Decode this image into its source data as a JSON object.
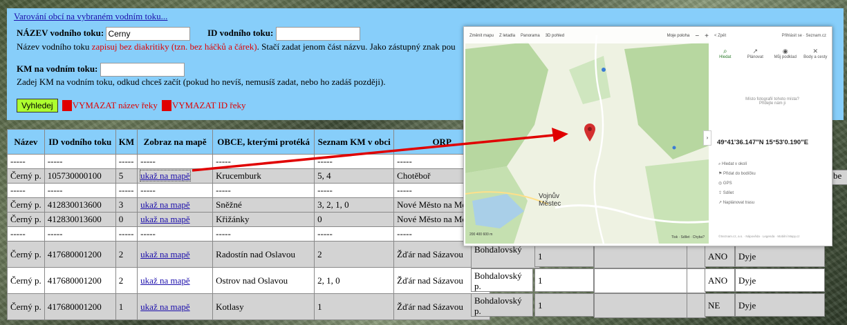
{
  "search": {
    "title_link": "Varování obcí na vybraném vodním toku...",
    "name_label": "NÁZEV vodního toku:",
    "name_value": "Cerny",
    "id_label": "ID vodního toku:",
    "id_value": "",
    "hint_prefix": "Název vodního toku ",
    "hint_red": "zapisuj bez diakritiky (tzn. bez háčků a čárek)",
    "hint_suffix": ". Stačí zadat jenom část názvu. Jako zástupný znak pou",
    "km_label": "KM na vodním toku:",
    "km_value": "",
    "km_hint": "Zadej KM na vodním toku, odkud chceš začít (pokud ho nevíš, nemusíš zadat, nebo ho zadáš později).",
    "search_button": "Vyhledej",
    "clear_name": "VYMAZAT název řeky",
    "clear_id": "VYMAZAT ID řeky"
  },
  "table": {
    "headers": [
      "Název",
      "ID vodního toku",
      "KM",
      "Zobraz na mapě",
      "OBCE, kterými protéká",
      "Seznam KM v obci",
      "ORP"
    ],
    "rows": [
      [
        "-----",
        "-----",
        "-----",
        "-----",
        "-----",
        "-----",
        "-----"
      ],
      [
        "Černý p.",
        "105730000100",
        "5",
        "ukaž na mapě",
        "Krucemburk",
        "5, 4",
        "Chotěboř"
      ],
      [
        "-----",
        "-----",
        "-----",
        "-----",
        "-----",
        "-----",
        "-----"
      ],
      [
        "Černý p.",
        "412830013600",
        "3",
        "ukaž na mapě",
        "Sněžné",
        "3, 2, 1, 0",
        "Nové Město na Morav"
      ],
      [
        "Černý p.",
        "412830013600",
        "0",
        "ukaž na mapě",
        "Křižánky",
        "0",
        "Nové Město na Morav"
      ],
      [
        "-----",
        "-----",
        "-----",
        "-----",
        "-----",
        "-----",
        "-----"
      ],
      [
        "Černý p.",
        "417680001200",
        "2",
        "ukaž na mapě",
        "Radostín nad Oslavou",
        "2",
        "Žďár nad Sázavou"
      ],
      [
        "Černý p.",
        "417680001200",
        "2",
        "ukaž na mapě",
        "Ostrov nad Oslavou",
        "2, 1, 0",
        "Žďár nad Sázavou"
      ],
      [
        "Černý p.",
        "417680001200",
        "1",
        "ukaž na mapě",
        "Kotlasy",
        "1",
        "Žďár nad Sázavou"
      ]
    ],
    "extra": {
      "r1_tail": "be",
      "r6_c1": "Bohdalovský",
      "r7_c1": "Bohdalovský p.",
      "r8_c1": "Bohdalovský p.",
      "c2": "1",
      "r6_c3": "ANO",
      "r7_c3": "ANO",
      "r8_c3": "NE",
      "c4": "Dyje"
    }
  },
  "map": {
    "topbar": [
      "Změnit mapu",
      "Z letadla",
      "Panorama",
      "3D pohled",
      "Moje poloha"
    ],
    "zoom_minus": "−",
    "zoom_plus": "+",
    "back": "< Zpět",
    "login": "Přihlásit se · Seznam.cz",
    "tabs": [
      "Hledat",
      "Plánovat",
      "Můj podklad",
      "Body a cesty"
    ],
    "note_line1": "Místo fotografií tohoto místa?",
    "note_line2": "Přidejte nám ji",
    "coordinates": "49°41'36.147\"N 15°53'0.190\"E",
    "menu": [
      "Hledat v okolí",
      "Přidat do bodíčku",
      "GPS",
      "Sdílet",
      "Naplánovat trasu"
    ],
    "places": [
      "Vojnův",
      "Městec"
    ],
    "footer": "©Seznam.cz, a.s. · Nápověda · Legenda · Mobilní Mapy.cz",
    "bottom_tools": "Tisk · Sdílet · Chyba?",
    "scale": "200  400  600 m"
  },
  "colors": {
    "panel": "#87cefa",
    "red": "#e00000",
    "search_btn": "#adff2f",
    "arrow": "#e00000",
    "pin": "#d32f2f"
  }
}
